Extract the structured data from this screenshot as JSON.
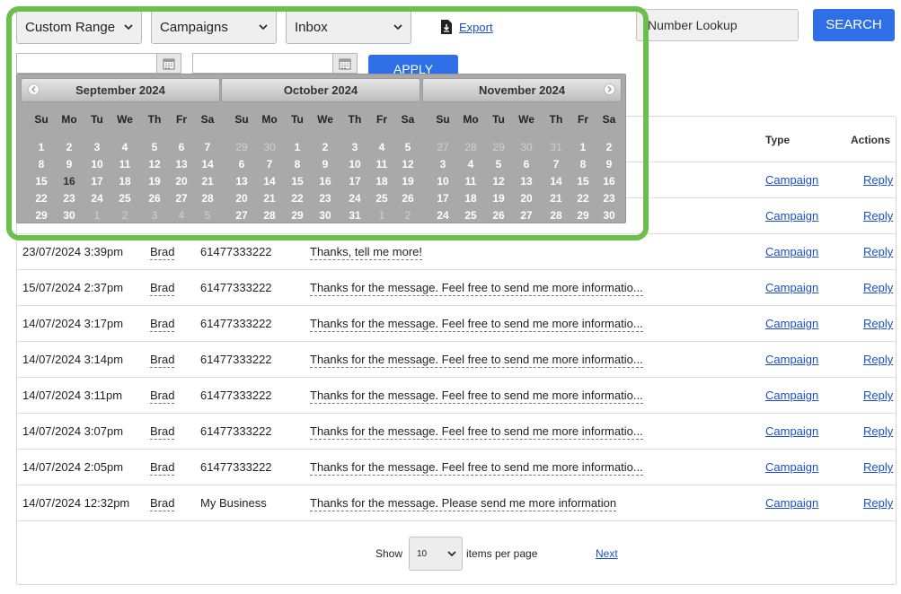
{
  "filters": {
    "date_range": "Custom Range",
    "type": "Campaigns",
    "folder": "Inbox",
    "export_label": "Export"
  },
  "search": {
    "number_lookup_value": "Number Lookup",
    "search_label": "SEARCH"
  },
  "date_inputs": {
    "from_value": "",
    "to_value": "",
    "apply_label": "APPLY"
  },
  "calendar": {
    "weekdays": [
      "Su",
      "Mo",
      "Tu",
      "We",
      "Th",
      "Fr",
      "Sa"
    ],
    "months": [
      {
        "title": "September 2024",
        "weeks": [
          [
            "1",
            "2",
            "3",
            "4",
            "5",
            "6",
            "7"
          ],
          [
            "8",
            "9",
            "10",
            "11",
            "12",
            "13",
            "14"
          ],
          [
            "15",
            "16",
            "17",
            "18",
            "19",
            "20",
            "21"
          ],
          [
            "22",
            "23",
            "24",
            "25",
            "26",
            "27",
            "28"
          ],
          [
            "29",
            "30",
            "1",
            "2",
            "3",
            "4",
            "5"
          ]
        ],
        "other_month_cells": [
          [
            4,
            2
          ],
          [
            4,
            3
          ],
          [
            4,
            4
          ],
          [
            4,
            5
          ],
          [
            4,
            6
          ]
        ],
        "today_cell": [
          2,
          1
        ]
      },
      {
        "title": "October 2024",
        "weeks": [
          [
            "29",
            "30",
            "1",
            "2",
            "3",
            "4",
            "5"
          ],
          [
            "6",
            "7",
            "8",
            "9",
            "10",
            "11",
            "12"
          ],
          [
            "13",
            "14",
            "15",
            "16",
            "17",
            "18",
            "19"
          ],
          [
            "20",
            "21",
            "22",
            "23",
            "24",
            "25",
            "26"
          ],
          [
            "27",
            "28",
            "29",
            "30",
            "31",
            "1",
            "2"
          ]
        ],
        "other_month_cells": [
          [
            0,
            0
          ],
          [
            0,
            1
          ],
          [
            4,
            5
          ],
          [
            4,
            6
          ]
        ],
        "today_cell": null
      },
      {
        "title": "November 2024",
        "weeks": [
          [
            "27",
            "28",
            "29",
            "30",
            "31",
            "1",
            "2"
          ],
          [
            "3",
            "4",
            "5",
            "6",
            "7",
            "8",
            "9"
          ],
          [
            "10",
            "11",
            "12",
            "13",
            "14",
            "15",
            "16"
          ],
          [
            "17",
            "18",
            "19",
            "20",
            "21",
            "22",
            "23"
          ],
          [
            "24",
            "25",
            "26",
            "27",
            "28",
            "29",
            "30"
          ]
        ],
        "other_month_cells": [
          [
            0,
            0
          ],
          [
            0,
            1
          ],
          [
            0,
            2
          ],
          [
            0,
            3
          ],
          [
            0,
            4
          ]
        ],
        "today_cell": null
      }
    ]
  },
  "table": {
    "headers": {
      "type": "Type",
      "actions": "Actions"
    },
    "rows": [
      {
        "datetime": "",
        "contact": "",
        "number": "",
        "message": "",
        "type": "Campaign",
        "action": "Reply"
      },
      {
        "datetime": "",
        "contact": "",
        "number": "",
        "message": "",
        "type": "Campaign",
        "action": "Reply"
      },
      {
        "datetime": "23/07/2024 3:39pm",
        "contact": "Brad",
        "number": "61477333222",
        "message": "Thanks, tell me more!",
        "type": "Campaign",
        "action": "Reply"
      },
      {
        "datetime": "15/07/2024 2:37pm",
        "contact": "Brad",
        "number": "61477333222",
        "message": "Thanks for the message. Feel free to send me more informatio...",
        "type": "Campaign",
        "action": "Reply"
      },
      {
        "datetime": "14/07/2024 3:17pm",
        "contact": "Brad",
        "number": "61477333222",
        "message": "Thanks for the message. Feel free to send me more informatio...",
        "type": "Campaign",
        "action": "Reply"
      },
      {
        "datetime": "14/07/2024 3:14pm",
        "contact": "Brad",
        "number": "61477333222",
        "message": "Thanks for the message. Feel free to send me more informatio...",
        "type": "Campaign",
        "action": "Reply"
      },
      {
        "datetime": "14/07/2024 3:11pm",
        "contact": "Brad",
        "number": "61477333222",
        "message": "Thanks for the message. Feel free to send me more informatio...",
        "type": "Campaign",
        "action": "Reply"
      },
      {
        "datetime": "14/07/2024 3:07pm",
        "contact": "Brad",
        "number": "61477333222",
        "message": "Thanks for the message. Feel free to send me more informatio...",
        "type": "Campaign",
        "action": "Reply"
      },
      {
        "datetime": "14/07/2024 2:05pm",
        "contact": "Brad",
        "number": "61477333222",
        "message": "Thanks for the message. Feel free to send me more informatio...",
        "type": "Campaign",
        "action": "Reply"
      },
      {
        "datetime": "14/07/2024 12:32pm",
        "contact": "Brad",
        "number": "My Business",
        "message": "Thanks for the message. Please send me more information",
        "type": "Campaign",
        "action": "Reply"
      }
    ]
  },
  "pagination": {
    "show_label": "Show",
    "per_page_value": "10",
    "items_label": "items per page",
    "next_label": "Next"
  },
  "colors": {
    "primary_button": "#2e6fe8",
    "link": "#1a4fd0",
    "highlight": "#6cbf4b",
    "calendar_bg": "#a9a9a9"
  },
  "icons": [
    "chevron-down-icon",
    "download-file-icon",
    "calendar-icon",
    "chevron-left-icon",
    "chevron-right-icon"
  ]
}
